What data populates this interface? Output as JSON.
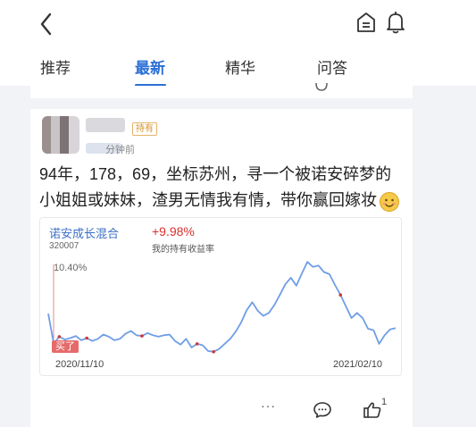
{
  "nav": {
    "back_icon": "chevron-left-icon",
    "home_icon": "home-icon",
    "notification_icon": "bell-icon"
  },
  "tabs": [
    {
      "label": "推荐",
      "active": false
    },
    {
      "label": "最新",
      "active": true
    },
    {
      "label": "精华",
      "active": false
    },
    {
      "label": "问答",
      "active": false
    }
  ],
  "post": {
    "badge": "持有",
    "time": "分钟前",
    "text": "94年，178，69，坐标苏州，寻一个被诺安碎梦的小姐姐或妹妹，渣男无情我有情，带你赢回嫁妆",
    "emoji_icon": "smile-emoji-icon",
    "fund": {
      "name": "诺安成长混合",
      "code": "320007",
      "return_value": "+9.98%",
      "return_caption": "我的持有收益率",
      "peak_label": "10.40%",
      "buy_label": "买了",
      "start_date": "2020/11/10",
      "end_date": "2021/02/10"
    },
    "actions": {
      "more_label": "···",
      "comment_icon": "comment-icon",
      "like_icon": "thumbs-up-icon",
      "like_count": "1"
    }
  },
  "colors": {
    "accent": "#2b6fd6",
    "line": "#6f9ee6",
    "return_red": "#d8312f",
    "marker_red": "#cc3b3b"
  },
  "chart_data": {
    "type": "line",
    "x_start": "2020/11/10",
    "x_end": "2021/02/10",
    "ylim": [
      -2.5,
      10.8
    ],
    "values": [
      3.2,
      -1.0,
      0.0,
      -0.4,
      -0.2,
      0.1,
      -0.5,
      -0.2,
      -0.6,
      -0.3,
      0.3,
      0.0,
      -0.5,
      -0.3,
      0.4,
      0.8,
      0.2,
      0.1,
      0.5,
      0.2,
      0.0,
      0.2,
      0.3,
      -0.6,
      -1.1,
      -0.3,
      -1.5,
      -1.0,
      -1.2,
      -2.0,
      -2.1,
      -1.7,
      -1.0,
      -0.3,
      0.7,
      2.0,
      3.7,
      4.8,
      3.6,
      2.9,
      3.3,
      4.4,
      5.8,
      7.3,
      8.2,
      7.1,
      8.8,
      10.4,
      9.7,
      9.9,
      9.0,
      8.7,
      7.2,
      5.8,
      4.2,
      2.6,
      3.3,
      2.6,
      1.1,
      0.9,
      -1.0,
      0.2,
      1.0,
      1.2
    ],
    "red_marker_indices": [
      2,
      7,
      17,
      27,
      30,
      53
    ]
  }
}
